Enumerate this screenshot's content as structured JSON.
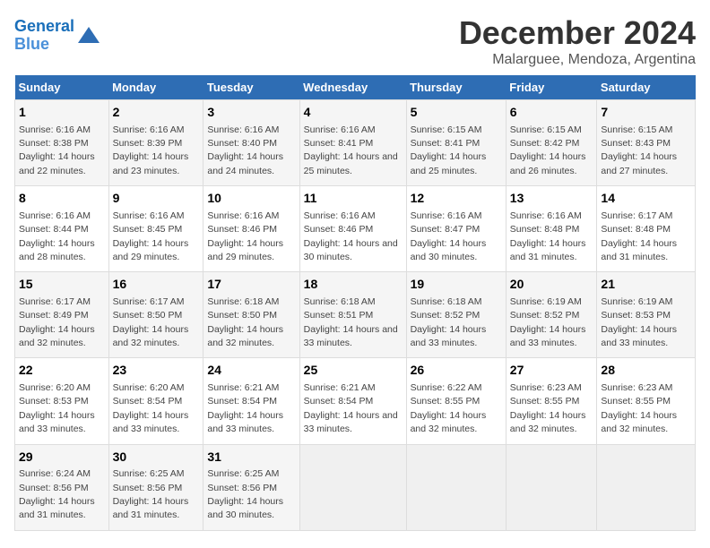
{
  "header": {
    "logo_line1": "General",
    "logo_line2": "Blue",
    "title": "December 2024",
    "subtitle": "Malarguee, Mendoza, Argentina"
  },
  "calendar": {
    "days_of_week": [
      "Sunday",
      "Monday",
      "Tuesday",
      "Wednesday",
      "Thursday",
      "Friday",
      "Saturday"
    ],
    "weeks": [
      [
        {
          "num": "1",
          "sunrise": "6:16 AM",
          "sunset": "8:38 PM",
          "daylight": "14 hours and 22 minutes."
        },
        {
          "num": "2",
          "sunrise": "6:16 AM",
          "sunset": "8:39 PM",
          "daylight": "14 hours and 23 minutes."
        },
        {
          "num": "3",
          "sunrise": "6:16 AM",
          "sunset": "8:40 PM",
          "daylight": "14 hours and 24 minutes."
        },
        {
          "num": "4",
          "sunrise": "6:16 AM",
          "sunset": "8:41 PM",
          "daylight": "14 hours and 25 minutes."
        },
        {
          "num": "5",
          "sunrise": "6:15 AM",
          "sunset": "8:41 PM",
          "daylight": "14 hours and 25 minutes."
        },
        {
          "num": "6",
          "sunrise": "6:15 AM",
          "sunset": "8:42 PM",
          "daylight": "14 hours and 26 minutes."
        },
        {
          "num": "7",
          "sunrise": "6:15 AM",
          "sunset": "8:43 PM",
          "daylight": "14 hours and 27 minutes."
        }
      ],
      [
        {
          "num": "8",
          "sunrise": "6:16 AM",
          "sunset": "8:44 PM",
          "daylight": "14 hours and 28 minutes."
        },
        {
          "num": "9",
          "sunrise": "6:16 AM",
          "sunset": "8:45 PM",
          "daylight": "14 hours and 29 minutes."
        },
        {
          "num": "10",
          "sunrise": "6:16 AM",
          "sunset": "8:46 PM",
          "daylight": "14 hours and 29 minutes."
        },
        {
          "num": "11",
          "sunrise": "6:16 AM",
          "sunset": "8:46 PM",
          "daylight": "14 hours and 30 minutes."
        },
        {
          "num": "12",
          "sunrise": "6:16 AM",
          "sunset": "8:47 PM",
          "daylight": "14 hours and 30 minutes."
        },
        {
          "num": "13",
          "sunrise": "6:16 AM",
          "sunset": "8:48 PM",
          "daylight": "14 hours and 31 minutes."
        },
        {
          "num": "14",
          "sunrise": "6:17 AM",
          "sunset": "8:48 PM",
          "daylight": "14 hours and 31 minutes."
        }
      ],
      [
        {
          "num": "15",
          "sunrise": "6:17 AM",
          "sunset": "8:49 PM",
          "daylight": "14 hours and 32 minutes."
        },
        {
          "num": "16",
          "sunrise": "6:17 AM",
          "sunset": "8:50 PM",
          "daylight": "14 hours and 32 minutes."
        },
        {
          "num": "17",
          "sunrise": "6:18 AM",
          "sunset": "8:50 PM",
          "daylight": "14 hours and 32 minutes."
        },
        {
          "num": "18",
          "sunrise": "6:18 AM",
          "sunset": "8:51 PM",
          "daylight": "14 hours and 33 minutes."
        },
        {
          "num": "19",
          "sunrise": "6:18 AM",
          "sunset": "8:52 PM",
          "daylight": "14 hours and 33 minutes."
        },
        {
          "num": "20",
          "sunrise": "6:19 AM",
          "sunset": "8:52 PM",
          "daylight": "14 hours and 33 minutes."
        },
        {
          "num": "21",
          "sunrise": "6:19 AM",
          "sunset": "8:53 PM",
          "daylight": "14 hours and 33 minutes."
        }
      ],
      [
        {
          "num": "22",
          "sunrise": "6:20 AM",
          "sunset": "8:53 PM",
          "daylight": "14 hours and 33 minutes."
        },
        {
          "num": "23",
          "sunrise": "6:20 AM",
          "sunset": "8:54 PM",
          "daylight": "14 hours and 33 minutes."
        },
        {
          "num": "24",
          "sunrise": "6:21 AM",
          "sunset": "8:54 PM",
          "daylight": "14 hours and 33 minutes."
        },
        {
          "num": "25",
          "sunrise": "6:21 AM",
          "sunset": "8:54 PM",
          "daylight": "14 hours and 33 minutes."
        },
        {
          "num": "26",
          "sunrise": "6:22 AM",
          "sunset": "8:55 PM",
          "daylight": "14 hours and 32 minutes."
        },
        {
          "num": "27",
          "sunrise": "6:23 AM",
          "sunset": "8:55 PM",
          "daylight": "14 hours and 32 minutes."
        },
        {
          "num": "28",
          "sunrise": "6:23 AM",
          "sunset": "8:55 PM",
          "daylight": "14 hours and 32 minutes."
        }
      ],
      [
        {
          "num": "29",
          "sunrise": "6:24 AM",
          "sunset": "8:56 PM",
          "daylight": "14 hours and 31 minutes."
        },
        {
          "num": "30",
          "sunrise": "6:25 AM",
          "sunset": "8:56 PM",
          "daylight": "14 hours and 31 minutes."
        },
        {
          "num": "31",
          "sunrise": "6:25 AM",
          "sunset": "8:56 PM",
          "daylight": "14 hours and 30 minutes."
        },
        null,
        null,
        null,
        null
      ]
    ]
  }
}
